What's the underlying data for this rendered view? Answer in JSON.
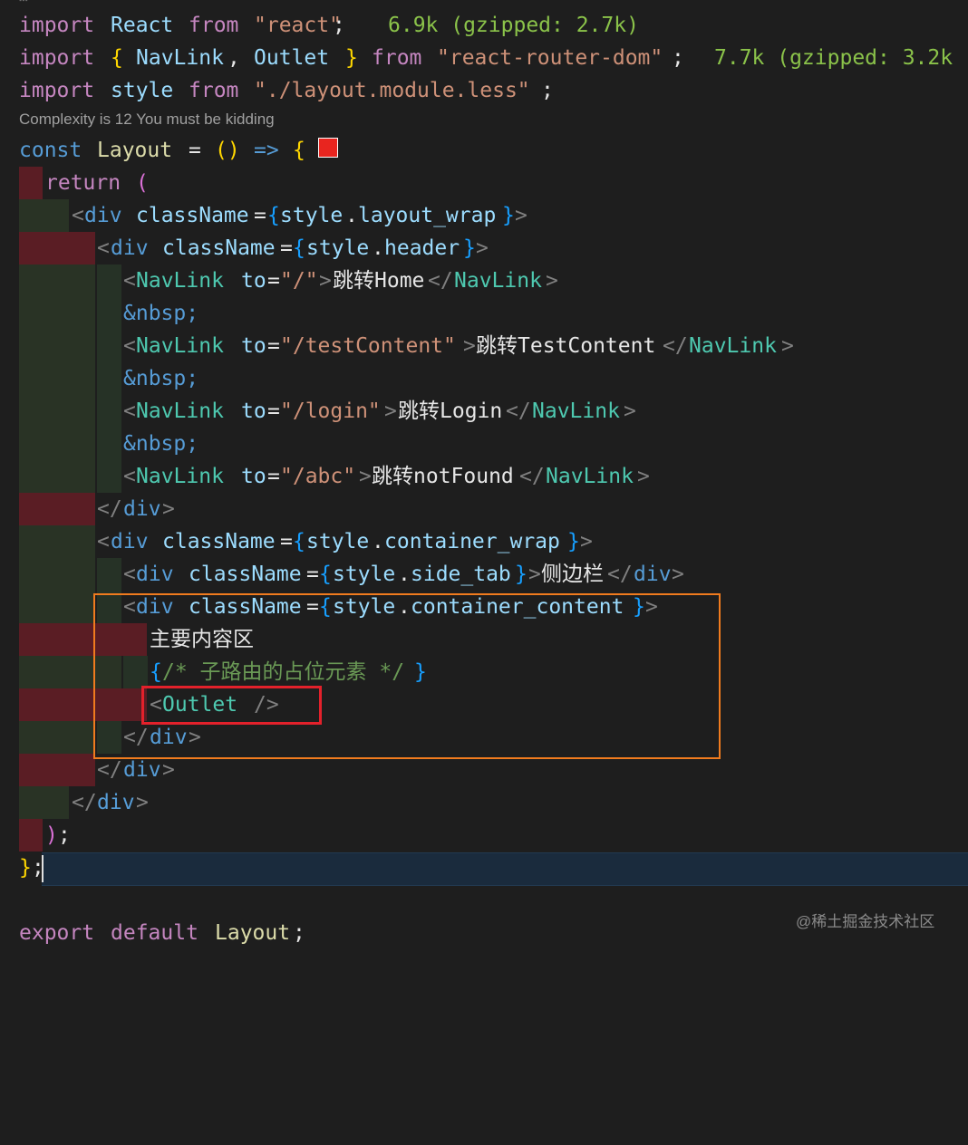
{
  "code": {
    "import_kw": "import",
    "from_kw": "from",
    "react_id": "React",
    "react_str": "\"react\"",
    "react_size_hint": "6.9k (gzipped: 2.7k)",
    "navlink_id": "NavLink",
    "outlet_id": "Outlet",
    "router_str": "\"react-router-dom\"",
    "router_size_hint": "7.7k (gzipped: 3.2k",
    "style_id": "style",
    "style_str": "\"./layout.module.less\"",
    "codelens": "Complexity is 12 You must be kidding",
    "const_kw": "const",
    "layout_fn": "Layout",
    "return_kw": "return",
    "div": "div",
    "classname": "className",
    "cls_layout_wrap": "layout_wrap",
    "cls_header": "header",
    "cls_container_wrap": "container_wrap",
    "cls_side_tab": "side_tab",
    "cls_container_content": "container_content",
    "to_attr": "to",
    "path_home": "\"/\"",
    "text_home": "跳转Home",
    "nbsp": "&nbsp;",
    "path_test": "\"/testContent\"",
    "text_test": "跳转TestContent",
    "path_login": "\"/login\"",
    "text_login": "跳转Login",
    "path_abc": "\"/abc\"",
    "text_notfound": "跳转notFound",
    "text_sidebar": "侧边栏",
    "text_main": "主要内容区",
    "comment": "/* 子路由的占位元素 */",
    "export_kw": "export",
    "default_kw": "default"
  },
  "watermark": "@稀土掘金技术社区",
  "colors": {
    "keyword": "#c586c0",
    "tag": "#4ec9b0",
    "string": "#ce9178",
    "highlight_box_outer": "#f07b1e",
    "highlight_box_inner": "#e3212b"
  }
}
